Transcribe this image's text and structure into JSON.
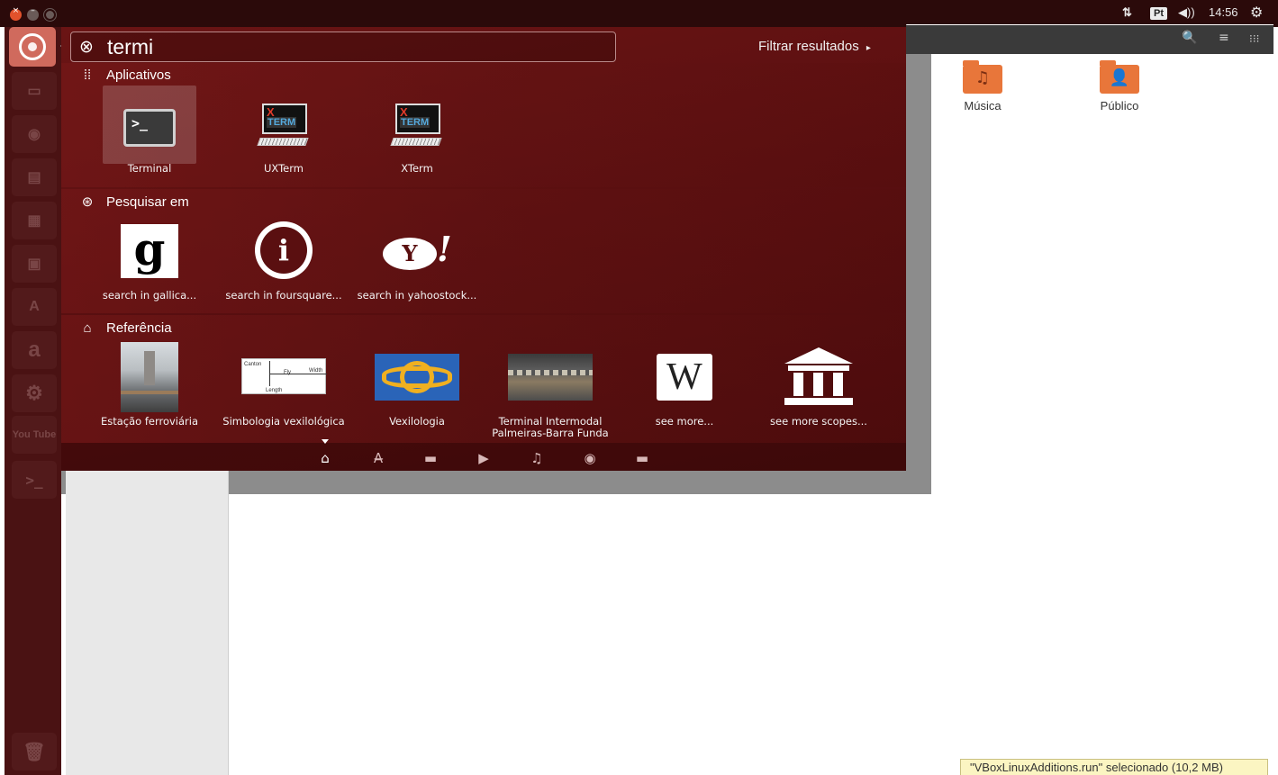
{
  "panel": {
    "window_close": "×",
    "window_minimize": "–",
    "window_maximize": "",
    "network_icon": "network-arrows-icon",
    "network_glyph": "⇅",
    "language": "Pt",
    "sound_glyph": "◀))",
    "clock": "14:56",
    "settings_glyph": "⚙"
  },
  "launcher": {
    "items": [
      {
        "name": "dash-home",
        "glyph": ""
      },
      {
        "name": "files",
        "glyph": "▭"
      },
      {
        "name": "firefox",
        "glyph": "◉"
      },
      {
        "name": "writer",
        "glyph": "▤"
      },
      {
        "name": "calc",
        "glyph": "▦"
      },
      {
        "name": "impress",
        "glyph": "▣"
      },
      {
        "name": "software-center",
        "glyph": "A"
      },
      {
        "name": "amazon",
        "glyph": "a"
      },
      {
        "name": "system-settings",
        "glyph": "⚙"
      },
      {
        "name": "youtube",
        "glyph": "You Tube"
      },
      {
        "name": "terminal",
        "glyph": ">_"
      },
      {
        "name": "trash",
        "glyph": "🗑"
      }
    ]
  },
  "dash": {
    "search": {
      "value": "termi",
      "clear_glyph": "⊗"
    },
    "filter_label": "Filtrar resultados",
    "filter_arrow": "▸",
    "sections": {
      "apps": {
        "title": "Aplicativos",
        "icon_glyph": "⁞⁞"
      },
      "search_in": {
        "title": "Pesquisar em",
        "icon_glyph": "⊛"
      },
      "reference": {
        "title": "Referência",
        "icon_glyph": "⌂"
      }
    },
    "apps": [
      {
        "label": "Terminal",
        "glyph": ">_"
      },
      {
        "label": "UXTerm",
        "x": "X",
        "t": "TERM"
      },
      {
        "label": "XTerm",
        "x": "X",
        "t": "TERM"
      }
    ],
    "search_results": [
      {
        "label": "search in gallica...",
        "glyph": "g"
      },
      {
        "label": "search in foursquare...",
        "glyph": "i"
      },
      {
        "label": "search in yahoostock...",
        "glyph": "Y",
        "bang": "!"
      }
    ],
    "reference": [
      {
        "label": "Estação ferroviária"
      },
      {
        "label": "Simbologia vexilológica",
        "diagram": {
          "t1": "Canton",
          "t2": "Fly",
          "t3": "Width",
          "t4": "Length"
        }
      },
      {
        "label": "Vexilologia"
      },
      {
        "label": "Terminal Intermodal Palmeiras-Barra Funda"
      },
      {
        "label": "see more...",
        "glyph": "W"
      },
      {
        "label": "see more scopes..."
      }
    ],
    "lenses": [
      {
        "name": "home",
        "glyph": "⌂",
        "active": true
      },
      {
        "name": "applications",
        "glyph": "A̶"
      },
      {
        "name": "files",
        "glyph": "▬"
      },
      {
        "name": "video",
        "glyph": "▶"
      },
      {
        "name": "music",
        "glyph": "♫"
      },
      {
        "name": "photos",
        "glyph": "◉"
      },
      {
        "name": "social",
        "glyph": "▬"
      }
    ]
  },
  "file_manager": {
    "toolbar": {
      "search_glyph": "🔍",
      "list_glyph": "≡",
      "grid_glyph": "⁝⁝⁝"
    },
    "folders": [
      {
        "label": "Música",
        "glyph": "♫"
      },
      {
        "label": "Público",
        "glyph": "👤"
      }
    ],
    "status": "\"VBoxLinuxAdditions.run\" selecionado  (10,2 MB)"
  }
}
